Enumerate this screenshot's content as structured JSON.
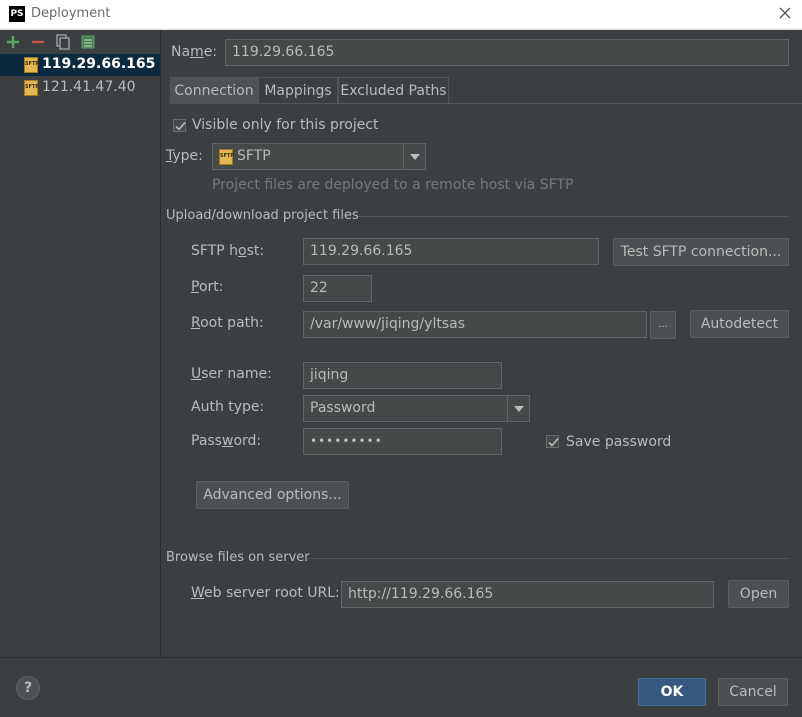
{
  "window": {
    "title": "Deployment",
    "app_icon": "PS"
  },
  "sidebar": {
    "toolbar": [
      {
        "icon": "add-icon"
      },
      {
        "icon": "remove-icon"
      },
      {
        "icon": "copy-icon"
      },
      {
        "icon": "set-default-icon"
      }
    ],
    "servers": [
      {
        "label": "119.29.66.165",
        "icon": "sftp-icon",
        "selected": true
      },
      {
        "label": "121.41.47.40",
        "icon": "sftp-icon",
        "selected": false
      }
    ]
  },
  "name": {
    "label": "Name:",
    "value": "119.29.66.165"
  },
  "tabs": [
    {
      "label": "Connection",
      "active": true
    },
    {
      "label": "Mappings",
      "active": false
    },
    {
      "label": "Excluded Paths",
      "active": false
    }
  ],
  "connection": {
    "visible_only": {
      "label": "Visible only for this project",
      "checked": true
    },
    "type": {
      "label": "Type:",
      "value": "SFTP",
      "hint": "Project files are deployed to a remote host via SFTP"
    },
    "upload_section": "Upload/download project files",
    "sftp_host": {
      "label": "SFTP host:",
      "value": "119.29.66.165",
      "test_button": "Test SFTP connection..."
    },
    "port": {
      "label": "Port:",
      "value": "22"
    },
    "root_path": {
      "label": "Root path:",
      "value": "/var/www/jiqing/yltsas",
      "browse_button": "...",
      "autodetect_button": "Autodetect"
    },
    "user_name": {
      "label": "User name:",
      "value": "jiqing"
    },
    "auth_type": {
      "label": "Auth type:",
      "value": "Password"
    },
    "password": {
      "label": "Password:",
      "value": "•••••••••"
    },
    "save_password": {
      "label": "Save password",
      "checked": true
    },
    "advanced_button": "Advanced options...",
    "browse_section": "Browse files on server",
    "web_url": {
      "label": "Web server root URL:",
      "value": "http://119.29.66.165",
      "open_button": "Open"
    }
  },
  "footer": {
    "help": "?",
    "ok": "OK",
    "cancel": "Cancel"
  },
  "colors": {
    "background": "#3c3f41",
    "selection": "#0d293e",
    "ok_button": "#365880",
    "add_icon": "#59a869",
    "remove_icon": "#c75450"
  }
}
